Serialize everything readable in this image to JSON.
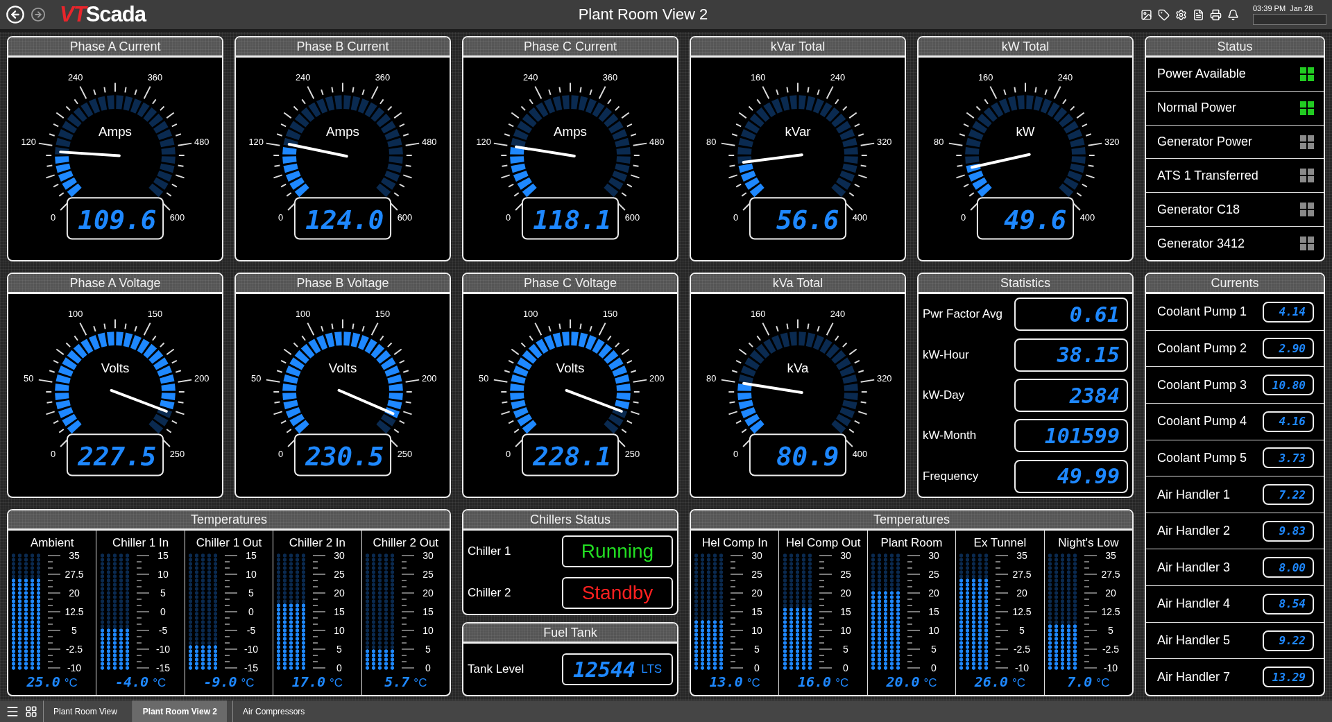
{
  "topbar": {
    "logo": {
      "accent": "VT",
      "rest": "Scada"
    },
    "title": "Plant Room View 2",
    "time": "03:39 PM",
    "date": "Jan 28"
  },
  "gauges": [
    {
      "title": "Phase A Current",
      "unit": "Amps",
      "ticks": [
        "0",
        "120",
        "240",
        "360",
        "480",
        "600"
      ],
      "reading": "109.6",
      "level": 0.18
    },
    {
      "title": "Phase B Current",
      "unit": "Amps",
      "ticks": [
        "0",
        "120",
        "240",
        "360",
        "480",
        "600"
      ],
      "reading": "124.0",
      "level": 0.21
    },
    {
      "title": "Phase C Current",
      "unit": "Amps",
      "ticks": [
        "0",
        "120",
        "240",
        "360",
        "480",
        "600"
      ],
      "reading": "118.1",
      "level": 0.2
    },
    {
      "title": "kVar Total",
      "unit": "kVar",
      "ticks": [
        "0",
        "80",
        "160",
        "240",
        "320",
        "400"
      ],
      "reading": "56.6",
      "level": 0.14
    },
    {
      "title": "kW Total",
      "unit": "kW",
      "ticks": [
        "0",
        "80",
        "160",
        "240",
        "320",
        "400"
      ],
      "reading": "49.6",
      "level": 0.12
    },
    {
      "title": "Phase A Voltage",
      "unit": "Volts",
      "ticks": [
        "0",
        "50",
        "100",
        "150",
        "200",
        "250"
      ],
      "reading": "227.5",
      "level": 0.91
    },
    {
      "title": "Phase B Voltage",
      "unit": "Volts",
      "ticks": [
        "0",
        "50",
        "100",
        "150",
        "200",
        "250"
      ],
      "reading": "230.5",
      "level": 0.92
    },
    {
      "title": "Phase C Voltage",
      "unit": "Volts",
      "ticks": [
        "0",
        "50",
        "100",
        "150",
        "200",
        "250"
      ],
      "reading": "228.1",
      "level": 0.91
    },
    {
      "title": "kVa Total",
      "unit": "kVa",
      "ticks": [
        "0",
        "80",
        "160",
        "240",
        "320",
        "400"
      ],
      "reading": "80.9",
      "level": 0.2
    }
  ],
  "status": {
    "title": "Status",
    "items": [
      {
        "label": "Power Available",
        "on": true
      },
      {
        "label": "Normal Power",
        "on": true
      },
      {
        "label": "Generator Power",
        "on": false
      },
      {
        "label": "ATS 1 Transferred",
        "on": false
      },
      {
        "label": "Generator C18",
        "on": false
      },
      {
        "label": "Generator 3412",
        "on": false
      }
    ]
  },
  "statistics": {
    "title": "Statistics",
    "rows": [
      {
        "label": "Pwr Factor Avg",
        "reading": "0.61"
      },
      {
        "label": "kW-Hour",
        "reading": "38.15"
      },
      {
        "label": "kW-Day",
        "reading": "2384"
      },
      {
        "label": "kW-Month",
        "reading": "101599"
      },
      {
        "label": "Frequency",
        "reading": "49.99"
      }
    ]
  },
  "currents": {
    "title": "Currents",
    "rows": [
      {
        "label": "Coolant Pump 1",
        "reading": "4.14"
      },
      {
        "label": "Coolant Pump 2",
        "reading": "2.90"
      },
      {
        "label": "Coolant Pump 3",
        "reading": "10.80"
      },
      {
        "label": "Coolant Pump 4",
        "reading": "4.16"
      },
      {
        "label": "Coolant Pump 5",
        "reading": "3.73"
      },
      {
        "label": "Air Handler 1",
        "reading": "7.22"
      },
      {
        "label": "Air Handler 2",
        "reading": "9.83"
      },
      {
        "label": "Air Handler 3",
        "reading": "8.00"
      },
      {
        "label": "Air Handler 4",
        "reading": "8.54"
      },
      {
        "label": "Air Handler 5",
        "reading": "9.22"
      },
      {
        "label": "Air Handler 7",
        "reading": "13.29"
      }
    ]
  },
  "temperatures": [
    {
      "title": "Temperatures",
      "sensors": [
        {
          "name": "Ambient",
          "ticks": [
            "35",
            "27.5",
            "20",
            "12.5",
            "5",
            "-2.5",
            "-10"
          ],
          "level": 0.78,
          "reading": "25.0",
          "unit": "°C"
        },
        {
          "name": "Chiller 1 In",
          "ticks": [
            "15",
            "10",
            "5",
            "0",
            "-5",
            "-10",
            "-15"
          ],
          "level": 0.37,
          "reading": "-4.0",
          "unit": "°C"
        },
        {
          "name": "Chiller 1 Out",
          "ticks": [
            "15",
            "10",
            "5",
            "0",
            "-5",
            "-10",
            "-15"
          ],
          "level": 0.2,
          "reading": "-9.0",
          "unit": "°C"
        },
        {
          "name": "Chiller 2 In",
          "ticks": [
            "30",
            "25",
            "20",
            "15",
            "10",
            "5",
            "0"
          ],
          "level": 0.57,
          "reading": "17.0",
          "unit": "°C"
        },
        {
          "name": "Chiller 2 Out",
          "ticks": [
            "30",
            "25",
            "20",
            "15",
            "10",
            "5",
            "0"
          ],
          "level": 0.19,
          "reading": "5.7",
          "unit": "°C"
        }
      ]
    },
    {
      "title": "Temperatures",
      "sensors": [
        {
          "name": "Hel Comp In",
          "ticks": [
            "30",
            "25",
            "20",
            "15",
            "10",
            "5",
            "0"
          ],
          "level": 0.43,
          "reading": "13.0",
          "unit": "°C"
        },
        {
          "name": "Hel Comp Out",
          "ticks": [
            "30",
            "25",
            "20",
            "15",
            "10",
            "5",
            "0"
          ],
          "level": 0.53,
          "reading": "16.0",
          "unit": "°C"
        },
        {
          "name": "Plant Room",
          "ticks": [
            "30",
            "25",
            "20",
            "15",
            "10",
            "5",
            "0"
          ],
          "level": 0.67,
          "reading": "20.0",
          "unit": "°C"
        },
        {
          "name": "Ex Tunnel",
          "ticks": [
            "35",
            "27.5",
            "20",
            "12.5",
            "5",
            "-2.5",
            "-10"
          ],
          "level": 0.8,
          "reading": "26.0",
          "unit": "°C"
        },
        {
          "name": "Night's Low",
          "ticks": [
            "35",
            "27.5",
            "20",
            "12.5",
            "5",
            "-2.5",
            "-10"
          ],
          "level": 0.38,
          "reading": "7.0",
          "unit": "°C"
        }
      ]
    }
  ],
  "chillers": {
    "title": "Chillers Status",
    "rows": [
      {
        "label": "Chiller 1",
        "state": "Running",
        "color": "#22dd22"
      },
      {
        "label": "Chiller 2",
        "state": "Standby",
        "color": "#ff2020"
      }
    ]
  },
  "fuel_tank": {
    "title": "Fuel Tank",
    "label": "Tank Level",
    "reading": "12544",
    "unit": "LTS"
  },
  "tabs": [
    {
      "label": "Plant Room View",
      "selected": false
    },
    {
      "label": "Plant Room View 2",
      "selected": true
    },
    {
      "label": "Air Compressors",
      "selected": false
    }
  ]
}
